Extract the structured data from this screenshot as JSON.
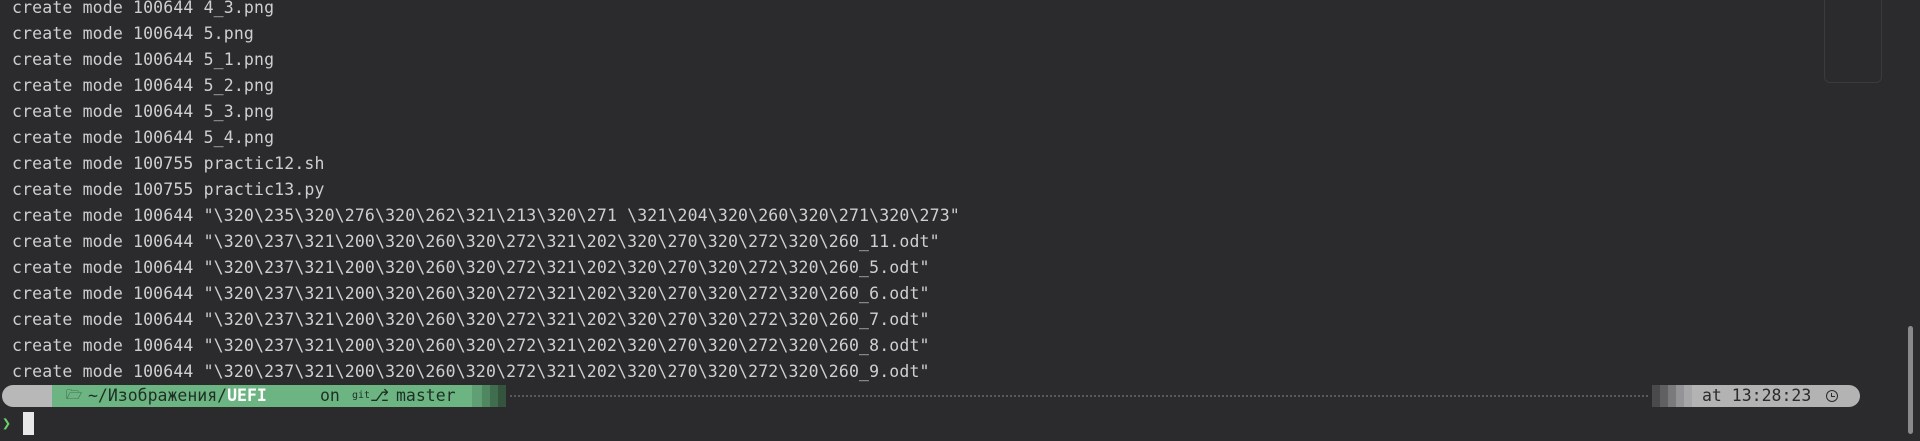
{
  "terminal": {
    "output_lines": [
      "create mode 100644 4_3.png",
      "create mode 100644 5.png",
      "create mode 100644 5_1.png",
      "create mode 100644 5_2.png",
      "create mode 100644 5_3.png",
      "create mode 100644 5_4.png",
      "create mode 100755 practic12.sh",
      "create mode 100755 practic13.py",
      "create mode 100644 \"\\320\\235\\320\\276\\320\\262\\321\\213\\320\\271 \\321\\204\\320\\260\\320\\271\\320\\273\"",
      "create mode 100644 \"\\320\\237\\321\\200\\320\\260\\320\\272\\321\\202\\320\\270\\320\\272\\320\\260_11.odt\"",
      "create mode 100644 \"\\320\\237\\321\\200\\320\\260\\320\\272\\321\\202\\320\\270\\320\\272\\320\\260_5.odt\"",
      "create mode 100644 \"\\320\\237\\321\\200\\320\\260\\320\\272\\321\\202\\320\\270\\320\\272\\320\\260_6.odt\"",
      "create mode 100644 \"\\320\\237\\321\\200\\320\\260\\320\\272\\321\\202\\320\\270\\320\\272\\320\\260_7.odt\"",
      "create mode 100644 \"\\320\\237\\321\\200\\320\\260\\320\\272\\321\\202\\320\\270\\320\\272\\320\\260_8.odt\"",
      "create mode 100644 \"\\320\\237\\321\\200\\320\\260\\320\\272\\321\\202\\320\\270\\320\\272\\320\\260_9.odt\""
    ]
  },
  "prompt": {
    "os_icon": "linux-os-icon",
    "folder_icon": "folder-icon",
    "path_prefix": "~/Изображения/",
    "path_current": "UEFI",
    "on_label": "on",
    "git_icon": "git-icon",
    "branch_icon": "branch-icon",
    "branch": "master",
    "time_label": "at 13:28:23",
    "clock_icon": "clock-icon",
    "input_chevron": "❯",
    "input_value": ""
  },
  "colors": {
    "background": "#2b2b2e",
    "text": "#cfcfcf",
    "dir_segment": "#6cb583",
    "os_segment": "#b8b8b8",
    "time_segment": "#b3b3b3",
    "prompt_chevron": "#6cd36c"
  }
}
